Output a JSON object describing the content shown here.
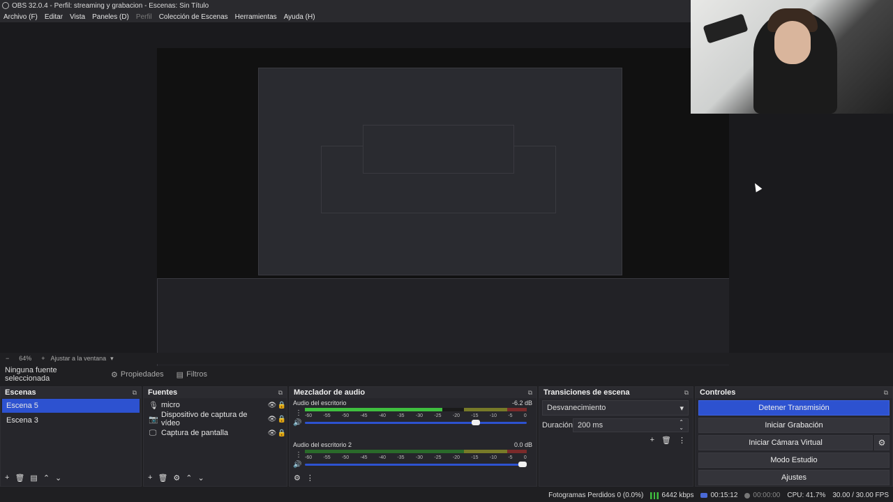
{
  "window": {
    "title": "OBS 32.0.4 - Perfil: streaming y grabacion - Escenas: Sin Título"
  },
  "menu": [
    {
      "label": "Archivo (F)",
      "enabled": true
    },
    {
      "label": "Editar",
      "enabled": true
    },
    {
      "label": "Vista",
      "enabled": true
    },
    {
      "label": "Paneles (D)",
      "enabled": true
    },
    {
      "label": "Perfil",
      "enabled": false
    },
    {
      "label": "Colección de Escenas",
      "enabled": true
    },
    {
      "label": "Herramientas",
      "enabled": true
    },
    {
      "label": "Ayuda (H)",
      "enabled": true
    }
  ],
  "zoom": {
    "level": "64%",
    "fit_label": "Ajustar a la ventana"
  },
  "source_toolbar": {
    "no_source": "Ninguna fuente seleccionada",
    "properties": "Propiedades",
    "filters": "Filtros"
  },
  "scenes": {
    "title": "Escenas",
    "items": [
      {
        "label": "Escena 5",
        "selected": true
      },
      {
        "label": "Escena 3",
        "selected": false
      }
    ]
  },
  "sources": {
    "title": "Fuentes",
    "items": [
      {
        "label": "micro",
        "icon": "mic-icon"
      },
      {
        "label": "Dispositivo de captura de vídeo",
        "icon": "camera-icon"
      },
      {
        "label": "Captura de pantalla",
        "icon": "monitor-icon"
      }
    ]
  },
  "mixer": {
    "title": "Mezclador de audio",
    "channels": [
      {
        "name": "Audio del escritorio",
        "db": "-6.2 dB",
        "level": 0.62,
        "volume": 0.78,
        "active": true
      },
      {
        "name": "Audio del escritorio 2",
        "db": "0.0 dB",
        "level": 0.0,
        "volume": 1.0,
        "active": false
      }
    ],
    "scale": [
      "-60",
      "-55",
      "-50",
      "-45",
      "-40",
      "-35",
      "-30",
      "-25",
      "-20",
      "-15",
      "-10",
      "-5",
      "0"
    ]
  },
  "transitions": {
    "title": "Transiciones de escena",
    "selected": "Desvanecimiento",
    "duration_label": "Duración",
    "duration_value": "200 ms"
  },
  "controls": {
    "title": "Controles",
    "stop_stream": "Detener Transmisión",
    "start_record": "Iniciar Grabación",
    "start_virtual_cam": "Iniciar Cámara Virtual",
    "studio_mode": "Modo Estudio",
    "settings": "Ajustes"
  },
  "status": {
    "dropped_frames": "Fotogramas Perdidos 0 (0.0%)",
    "bitrate": "6442 kbps",
    "stream_time": "00:15:12",
    "record_time": "00:00:00",
    "cpu": "CPU: 41.7%",
    "fps": "30.00 / 30.00 FPS"
  },
  "colors": {
    "accent": "#2d52d0",
    "meter_green": "#3fbf3f",
    "meter_yellow": "#777a28",
    "meter_red": "#7a2a2a"
  }
}
